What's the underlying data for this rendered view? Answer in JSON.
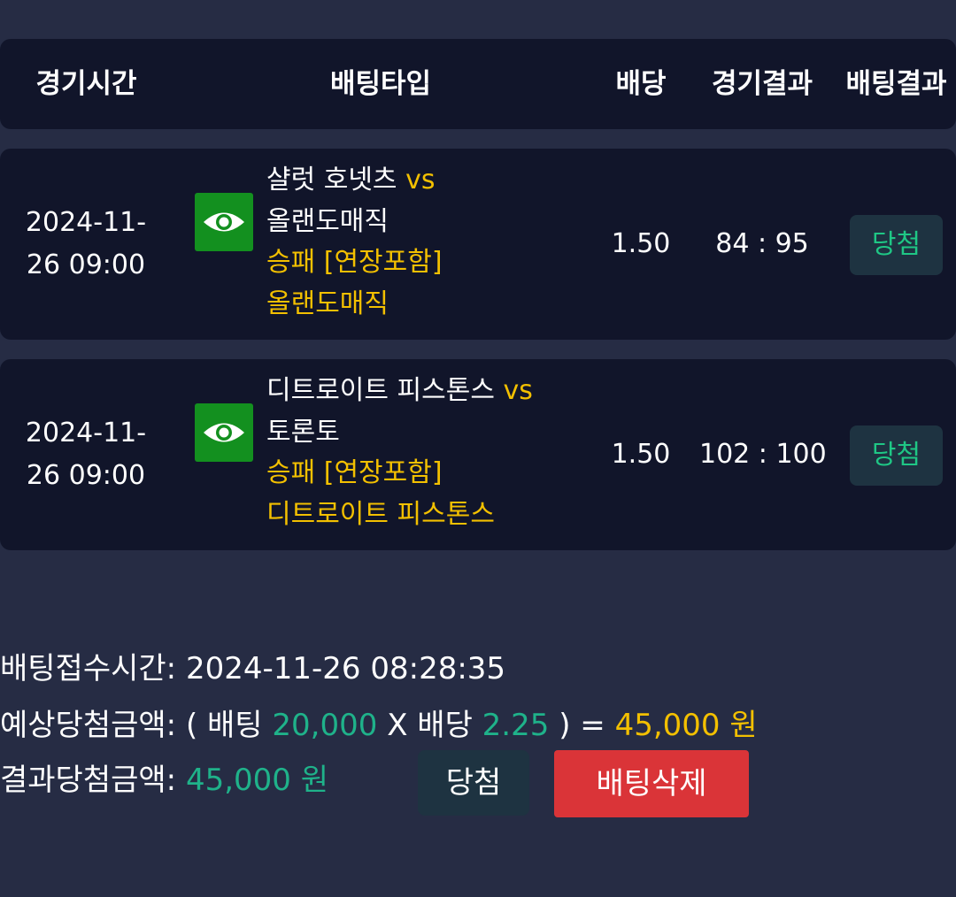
{
  "header": {
    "col_time": "경기시간",
    "col_type": "배팅타입",
    "col_odds": "배당",
    "col_game_result": "경기결과",
    "col_bet_result": "배팅결과"
  },
  "bets": [
    {
      "date": "2024-11-",
      "time": "26 09:00",
      "home": "샬럿 호넷츠",
      "vs": "vs",
      "away": "올랜도매직",
      "market": "승패 [연장포함]",
      "pick": "올랜도매직",
      "odds": "1.50",
      "score": "84 : 95",
      "result": "당첨",
      "icon": "eye-icon"
    },
    {
      "date": "2024-11-",
      "time": "26 09:00",
      "home": "디트로이트 피스톤스",
      "vs": "vs",
      "away": "토론토",
      "market": "승패 [연장포함]",
      "pick": "디트로이트 피스톤스",
      "odds": "1.50",
      "score": "102 : 100",
      "result": "당첨",
      "icon": "eye-icon"
    }
  ],
  "summary": {
    "accept_label": "배팅접수시간:",
    "accept_value": "2024-11-26 08:28:35",
    "expected_label": "예상당첨금액:",
    "open_paren": "(",
    "bet_word": "배팅",
    "bet_amount": "20,000",
    "times": "X",
    "odds_word": "배당",
    "total_odds": "2.25",
    "close_eq": ") =",
    "expected_amount": "45,000 원",
    "result_label": "결과당첨금액:",
    "result_amount": "45,000 원"
  },
  "buttons": {
    "win": "당첨",
    "delete": "배팅삭제"
  },
  "colors": {
    "background": "#262c44",
    "panel": "#11152a",
    "accent_yellow": "#f3c000",
    "accent_green": "#1fb28a",
    "win_badge_text": "#1fc785",
    "delete_button": "#da3438",
    "eye_icon_bg": "#13901f"
  }
}
